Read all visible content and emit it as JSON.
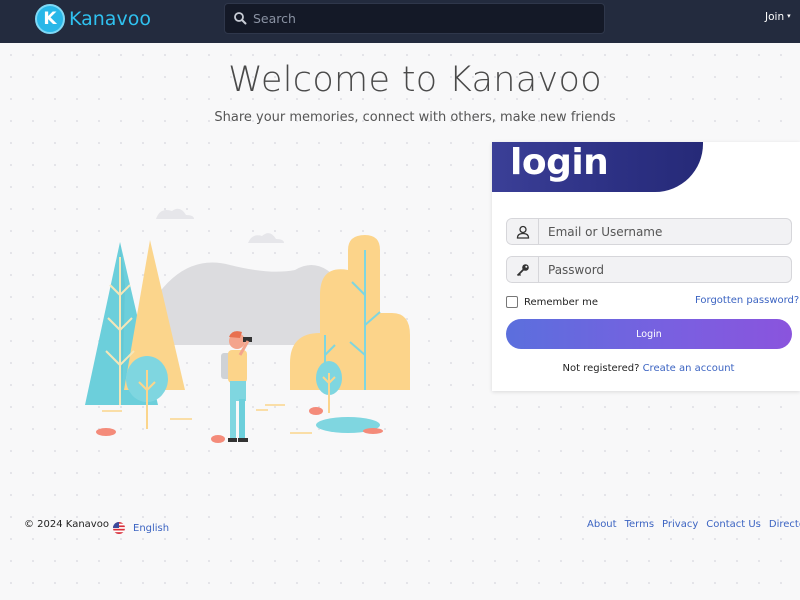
{
  "header": {
    "logo_letter": "K",
    "logo_text": "Kanavoo",
    "search_placeholder": "Search",
    "search_value": "",
    "join_label": "Join",
    "join_caret": "▾"
  },
  "hero": {
    "title": "Welcome to Kanavoo",
    "subtitle": "Share your memories, connect with others, make new friends"
  },
  "login": {
    "title": "login",
    "email_placeholder": "Email or Username",
    "password_placeholder": "Password",
    "remember_label": "Remember me",
    "remember_checked": false,
    "forgot_label": "Forgotten password?",
    "button_label": "Login",
    "not_registered": "Not registered?",
    "create_account": "Create an account"
  },
  "footer": {
    "copyright": "© 2024 Kanavoo",
    "language": "English",
    "links": [
      "About",
      "Terms",
      "Privacy",
      "Contact Us",
      "Directory"
    ]
  },
  "colors": {
    "header_bg": "#232b3e",
    "brand": "#2fc1ef",
    "banner": "#2c3083",
    "button_start": "#5b6fdd",
    "button_end": "#8a54dd",
    "link": "#3c64c2"
  },
  "icons": {
    "search": "search-icon",
    "user": "user-icon",
    "key": "key-icon",
    "flag": "us-flag-icon"
  }
}
